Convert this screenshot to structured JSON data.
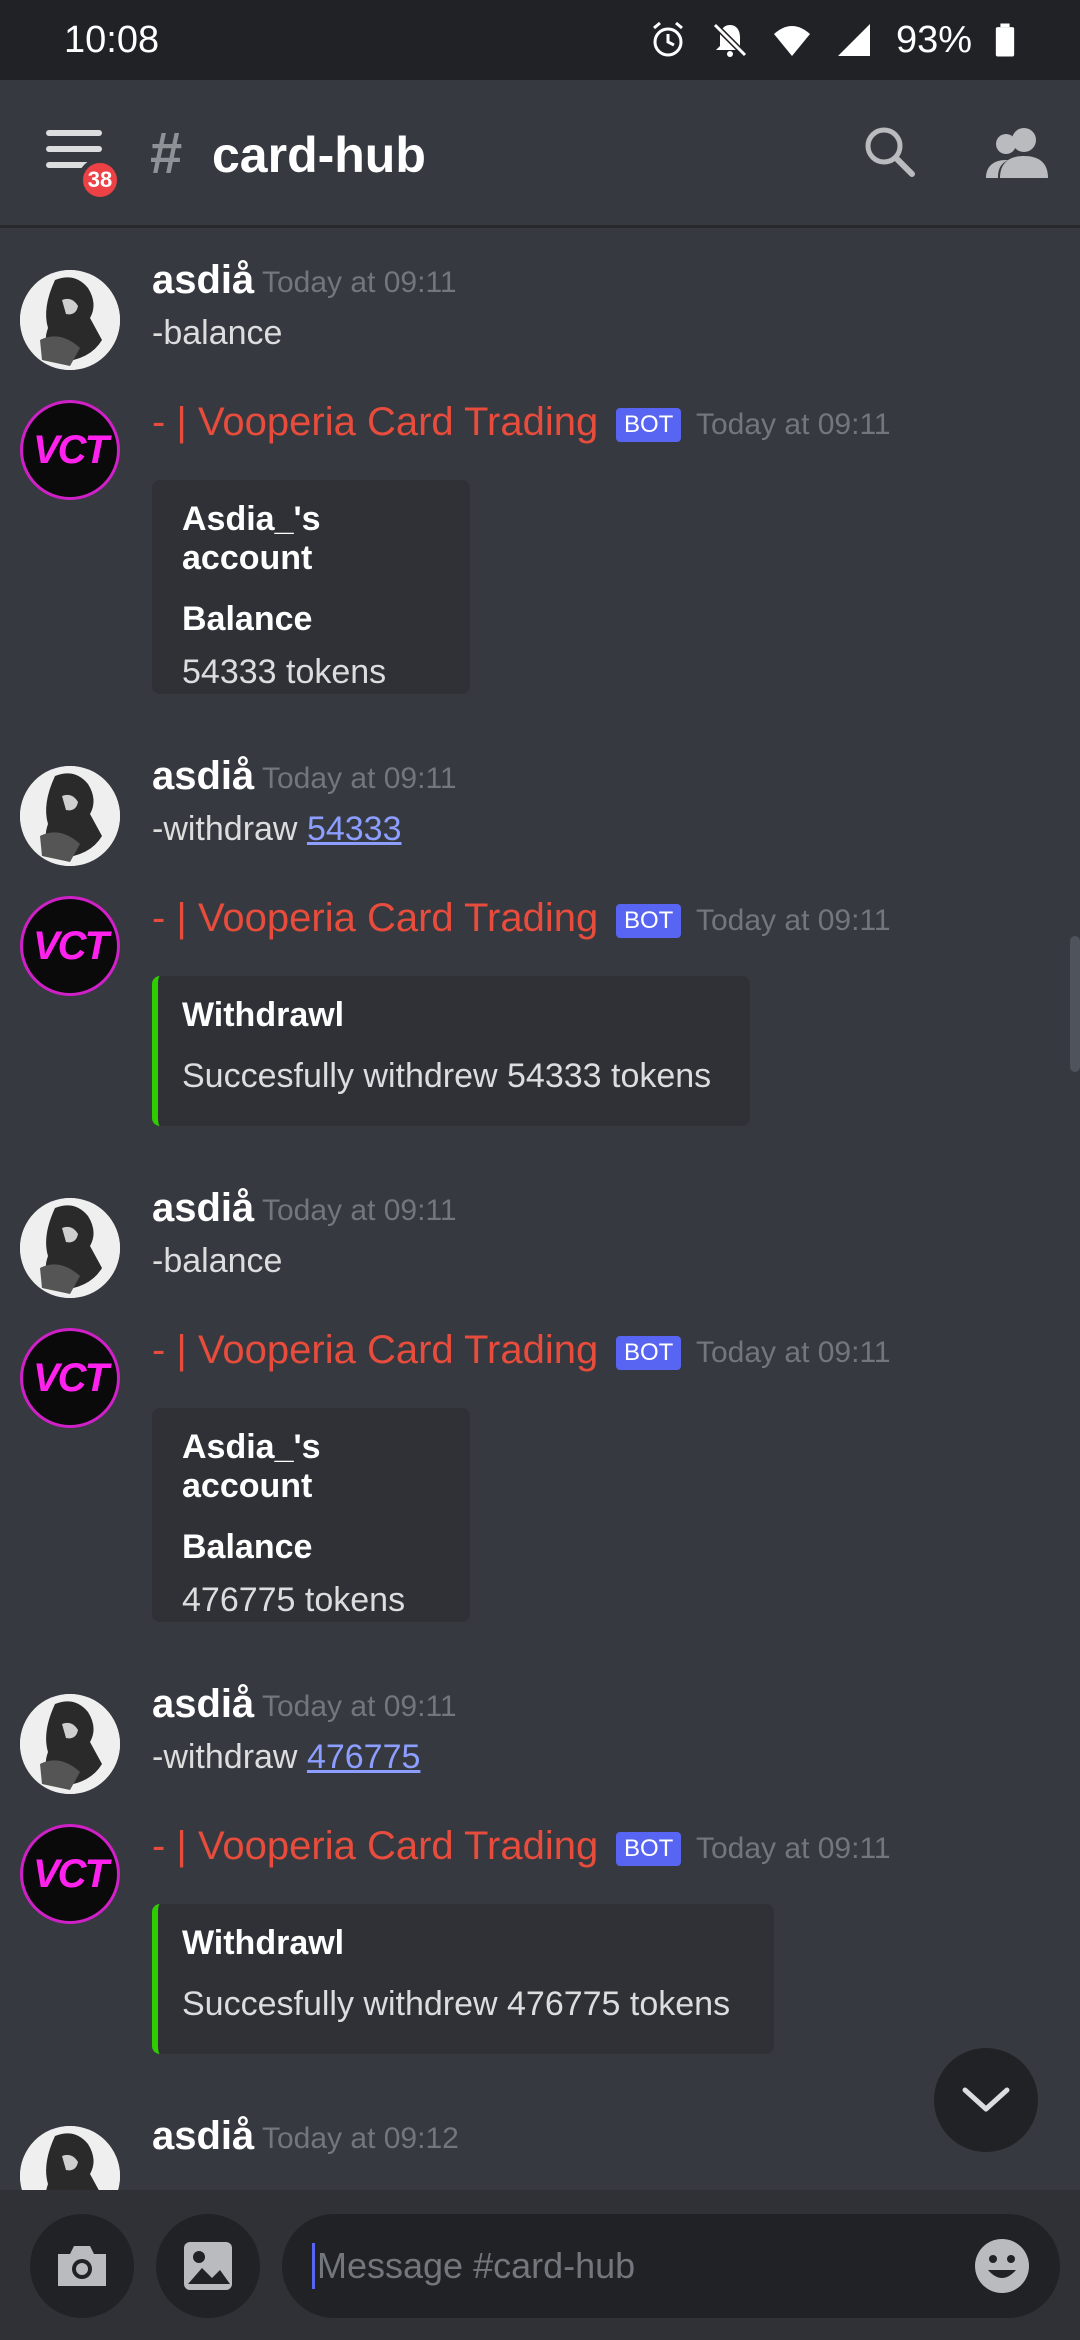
{
  "status_bar": {
    "time": "10:08",
    "battery": "93%",
    "icons": [
      "alarm-icon",
      "mute-icon",
      "wifi-icon",
      "signal-icon",
      "battery-icon"
    ]
  },
  "header": {
    "channel_hash": "#",
    "channel_name": "card-hub",
    "mention_count": "38"
  },
  "messages": [
    {
      "author": "asdiå",
      "time": "Today at 09:11",
      "text": "-balance"
    },
    {
      "author": "- | Vooperia Card Trading",
      "bot_tag": "BOT",
      "time": "Today at 09:11",
      "embed": {
        "title": "Asdia_'s account",
        "field_name": "Balance",
        "field_value": "54333 tokens"
      }
    },
    {
      "author": "asdiå",
      "time": "Today at 09:11",
      "text_prefix": "-withdraw ",
      "text_link": "54333"
    },
    {
      "author": "- | Vooperia Card Trading",
      "bot_tag": "BOT",
      "time": "Today at 09:11",
      "embed": {
        "title": "Withdrawl",
        "description": "Succesfully withdrew 54333 tokens"
      }
    },
    {
      "author": "asdiå",
      "time": "Today at 09:11",
      "text": "-balance"
    },
    {
      "author": "- | Vooperia Card Trading",
      "bot_tag": "BOT",
      "time": "Today at 09:11",
      "embed": {
        "title": "Asdia_'s account",
        "field_name": "Balance",
        "field_value": "476775 tokens"
      }
    },
    {
      "author": "asdiå",
      "time": "Today at 09:11",
      "text_prefix": "-withdraw ",
      "text_link": "476775"
    },
    {
      "author": "- | Vooperia Card Trading",
      "bot_tag": "BOT",
      "time": "Today at 09:11",
      "embed": {
        "title": "Withdrawl",
        "description": "Succesfully withdrew 476775 tokens"
      }
    },
    {
      "author": "asdiå",
      "time": "Today at 09:12"
    }
  ],
  "bot_avatar_text": "VCT",
  "composer": {
    "placeholder": "Message #card-hub"
  },
  "colors": {
    "background": "#36393f",
    "bot_name": "#e74c3c",
    "bot_tag": "#5865f2",
    "embed_accent_green": "#2ecc00",
    "link": "#8c9eff"
  }
}
